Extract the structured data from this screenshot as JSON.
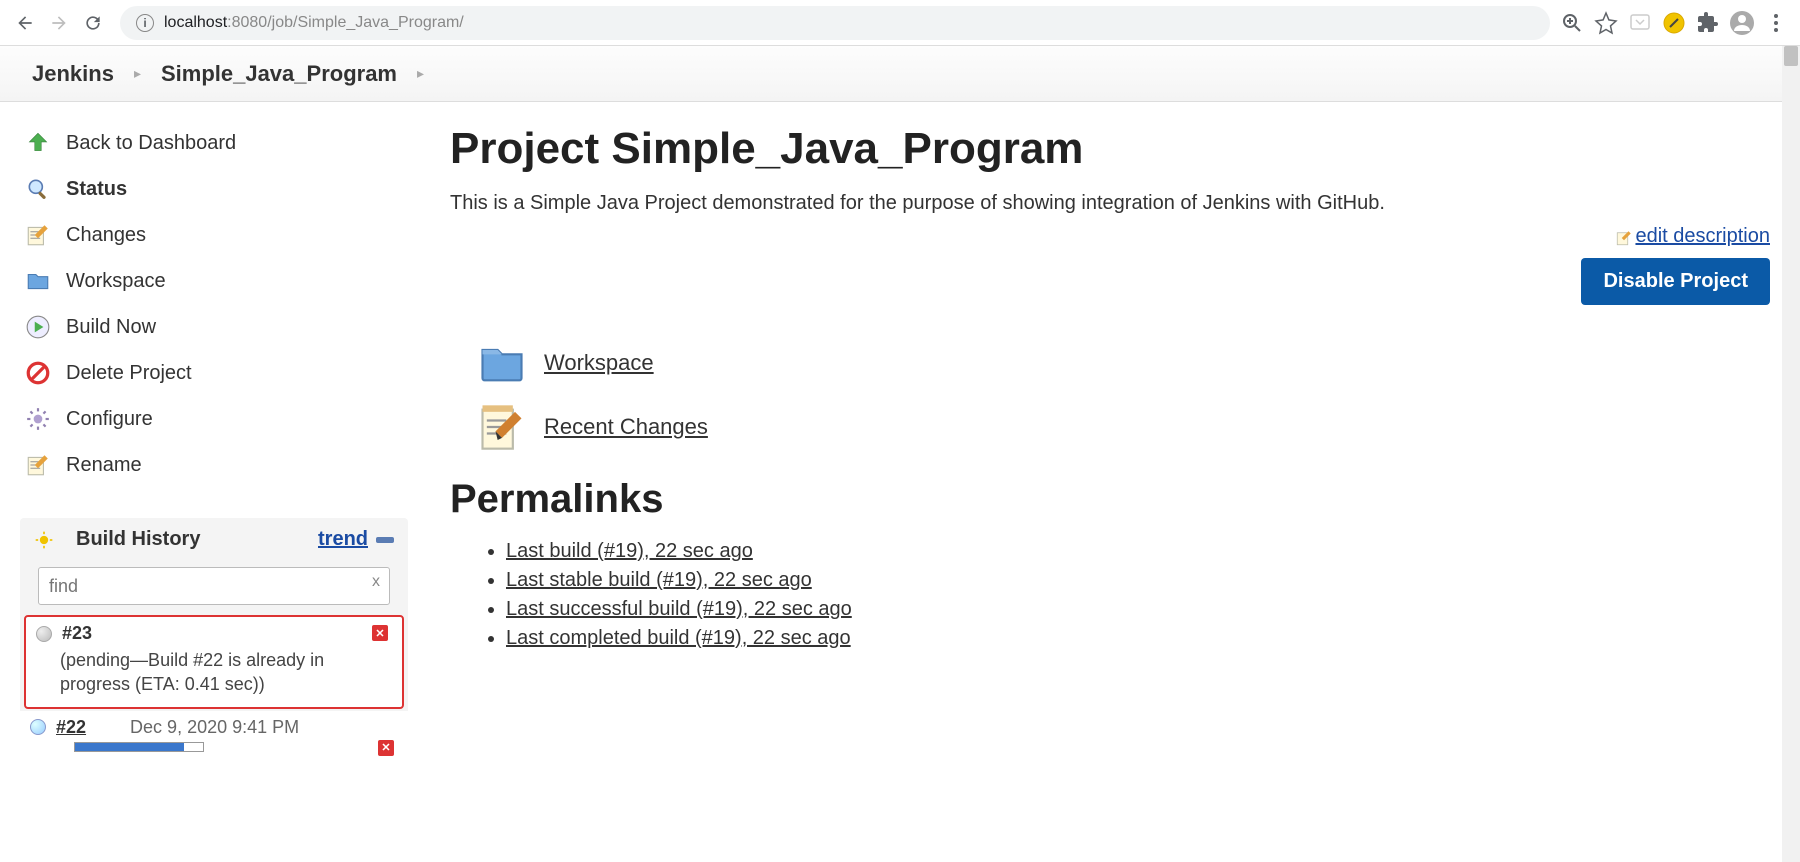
{
  "browser": {
    "url_host": "localhost",
    "url_port_path": ":8080/job/Simple_Java_Program/"
  },
  "breadcrumb": {
    "items": [
      "Jenkins",
      "Simple_Java_Program"
    ]
  },
  "sidebar": {
    "items": [
      {
        "label": "Back to Dashboard",
        "icon": "arrow-up-green"
      },
      {
        "label": "Status",
        "icon": "magnifier"
      },
      {
        "label": "Changes",
        "icon": "notepad-pencil"
      },
      {
        "label": "Workspace",
        "icon": "folder-blue"
      },
      {
        "label": "Build Now",
        "icon": "run-arrow"
      },
      {
        "label": "Delete Project",
        "icon": "no-entry"
      },
      {
        "label": "Configure",
        "icon": "gear-purple"
      },
      {
        "label": "Rename",
        "icon": "notepad-pencil"
      }
    ]
  },
  "build_history": {
    "title": "Build History",
    "trend_label": "trend",
    "search_placeholder": "find",
    "clear_label": "x",
    "builds": [
      {
        "num": "#23",
        "pending_msg": "(pending—Build #22 is already in progress (ETA: 0.41 sec))",
        "highlighted": true,
        "cancel": true
      },
      {
        "num": "#22",
        "date": "Dec 9, 2020 9:41 PM",
        "progress": 85,
        "link": true,
        "cancel": true
      }
    ]
  },
  "main": {
    "title": "Project Simple_Java_Program",
    "desc": "This is a Simple Java Project demonstrated for the purpose of showing integration of Jenkins with GitHub.",
    "edit_description": "edit description",
    "disable_label": "Disable Project",
    "workspace_label": "Workspace",
    "recent_changes_label": "Recent Changes",
    "permalinks_title": "Permalinks",
    "permalinks": [
      "Last build (#19), 22 sec ago",
      "Last stable build (#19), 22 sec ago",
      "Last successful build (#19), 22 sec ago",
      "Last completed build (#19), 22 sec ago"
    ]
  }
}
